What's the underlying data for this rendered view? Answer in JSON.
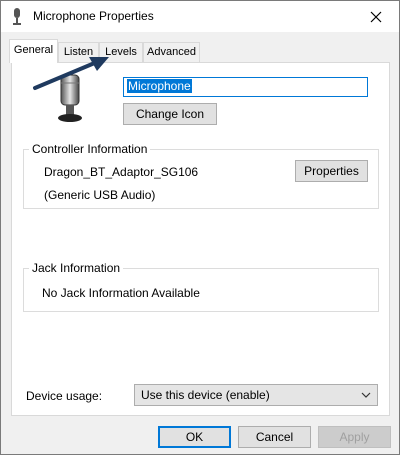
{
  "window": {
    "title": "Microphone Properties"
  },
  "tabs": [
    {
      "label": "General",
      "active": true
    },
    {
      "label": "Listen",
      "active": false
    },
    {
      "label": "Levels",
      "active": false
    },
    {
      "label": "Advanced",
      "active": false
    }
  ],
  "general": {
    "device_name_value": "Microphone",
    "change_icon_label": "Change Icon",
    "controller_section_title": "Controller Information",
    "controller_name": "Dragon_BT_Adaptor_SG106",
    "controller_type": "(Generic USB Audio)",
    "properties_label": "Properties",
    "jack_section_title": "Jack Information",
    "jack_info": "No Jack Information Available",
    "device_usage_label": "Device usage:",
    "device_usage_value": "Use this device (enable)"
  },
  "footer": {
    "ok_label": "OK",
    "cancel_label": "Cancel",
    "apply_label": "Apply"
  },
  "icons": {
    "title": "microphone-icon",
    "device": "microphone-icon",
    "close": "close-icon",
    "dropdown": "chevron-down-icon",
    "annotation": "arrow-annotation"
  },
  "colors": {
    "accent": "#0078d7",
    "annotation_arrow": "#1f3a5f"
  }
}
